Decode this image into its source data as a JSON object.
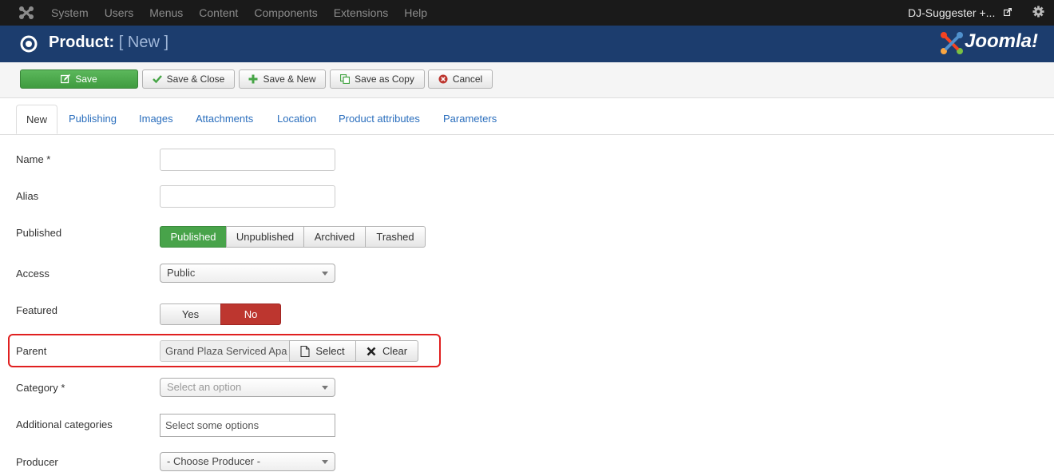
{
  "topnav": {
    "menu": [
      "System",
      "Users",
      "Menus",
      "Content",
      "Components",
      "Extensions",
      "Help"
    ],
    "site_name": "DJ-Suggester +...",
    "icons": {
      "logo": "joomla-icon",
      "external": "external-link-icon",
      "settings": "gear-icon"
    }
  },
  "header": {
    "title": "Product:",
    "subtitle": "[ New ]",
    "brand": "Joomla!"
  },
  "toolbar": {
    "save": "Save",
    "save_close": "Save & Close",
    "save_new": "Save & New",
    "save_copy": "Save as Copy",
    "cancel": "Cancel"
  },
  "tabs": [
    "New",
    "Publishing",
    "Images",
    "Attachments",
    "Location",
    "Product attributes",
    "Parameters"
  ],
  "form": {
    "name_label": "Name *",
    "name_value": "",
    "alias_label": "Alias",
    "alias_value": "",
    "published_label": "Published",
    "published_options": [
      "Published",
      "Unpublished",
      "Archived",
      "Trashed"
    ],
    "published_selected": "Published",
    "access_label": "Access",
    "access_value": "Public",
    "featured_label": "Featured",
    "featured_yes": "Yes",
    "featured_no": "No",
    "featured_selected": "No",
    "parent_label": "Parent",
    "parent_value": "Grand Plaza Serviced Apa",
    "parent_select": "Select",
    "parent_clear": "Clear",
    "category_label": "Category *",
    "category_placeholder": "Select an option",
    "additional_label": "Additional categories",
    "additional_placeholder": "Select some options",
    "producer_label": "Producer",
    "producer_value": "- Choose Producer -"
  },
  "colors": {
    "topnav_bg": "#1a1a1a",
    "header_bg": "#1c3d6e",
    "save_green": "#46a546",
    "published_green": "#48a34a",
    "no_red": "#bd362f",
    "highlight_red": "#e02020",
    "link_blue": "#2a6ebd"
  }
}
